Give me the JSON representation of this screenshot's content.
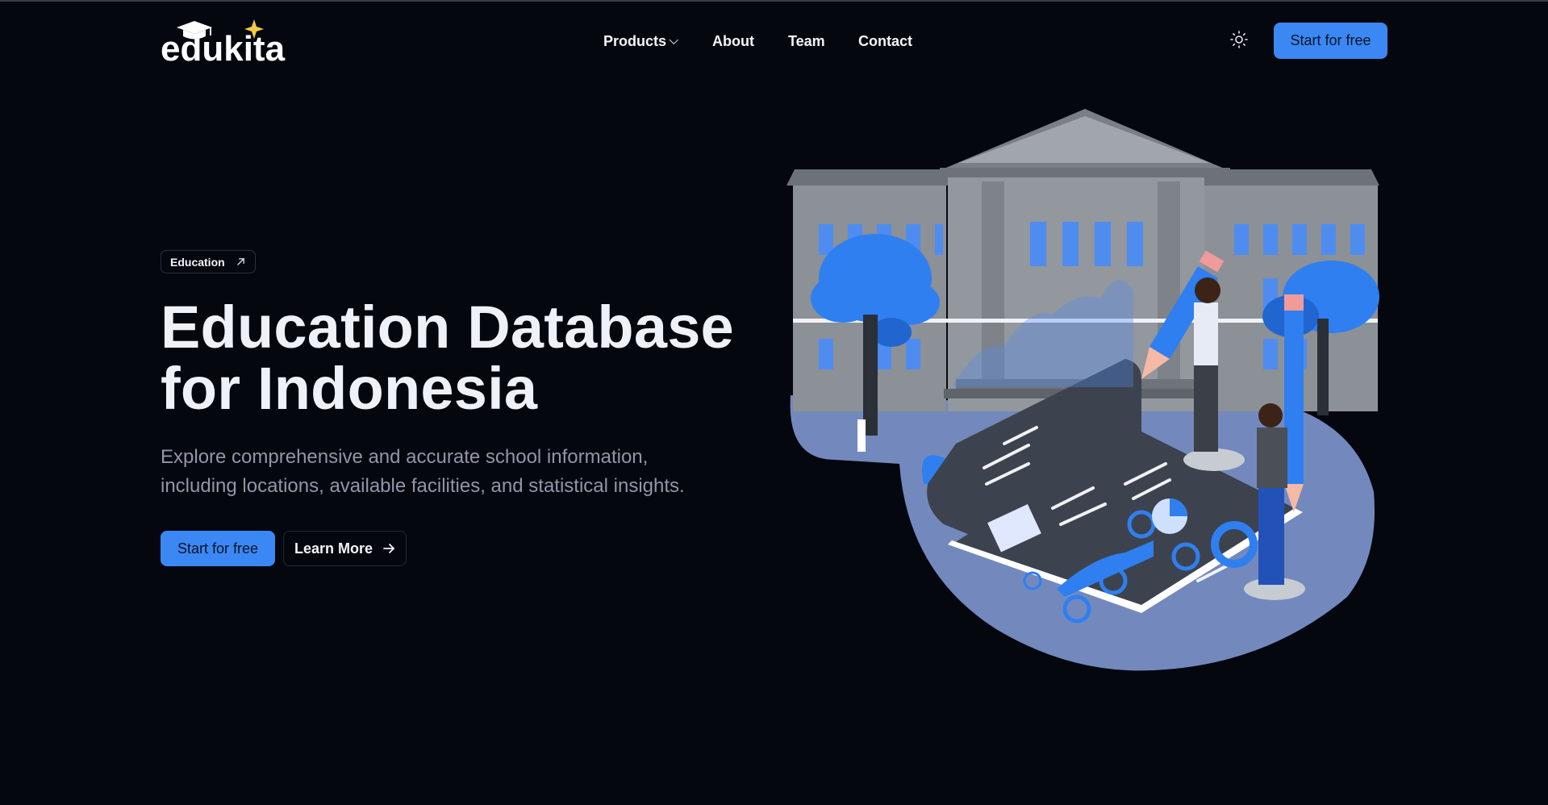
{
  "header": {
    "logo_text": "edukita",
    "nav": [
      {
        "label": "Products",
        "has_dropdown": true
      },
      {
        "label": "About"
      },
      {
        "label": "Team"
      },
      {
        "label": "Contact"
      }
    ],
    "theme_icon": "sun-icon",
    "cta_label": "Start for free"
  },
  "hero": {
    "badge_label": "Education",
    "badge_icon": "arrow-up-right-icon",
    "title_line1": "Education Database",
    "title_line2": "for Indonesia",
    "desc_line1": "Explore comprehensive and accurate school information,",
    "desc_line2": "including locations, available facilities, and statistical insights.",
    "primary_label": "Start for free",
    "secondary_label": "Learn More",
    "secondary_icon": "arrow-right-icon"
  },
  "colors": {
    "background": "#05070f",
    "accent": "#3b88f5",
    "muted_text": "#8f97a8"
  }
}
